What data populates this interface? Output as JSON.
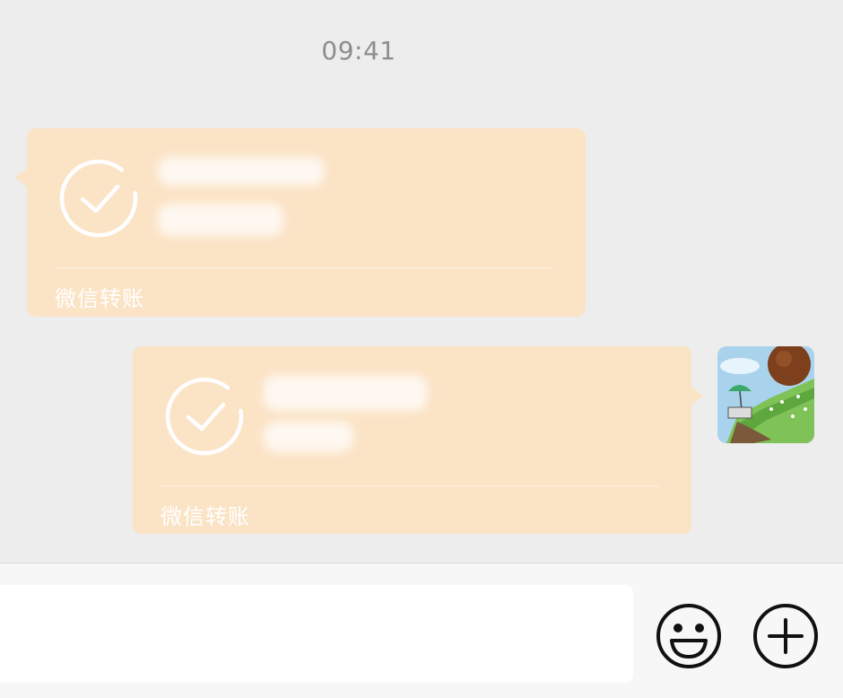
{
  "status": {
    "time": "09:41"
  },
  "messages": [
    {
      "side": "left",
      "type": "transfer",
      "icon": "check-circle-icon",
      "label": "微信转账",
      "amount_text": "",
      "note_text": ""
    },
    {
      "side": "right",
      "type": "transfer",
      "icon": "check-circle-icon",
      "label": "微信转账",
      "amount_text": "",
      "note_text": ""
    }
  ],
  "avatar": {
    "icon": "user-avatar-image"
  },
  "input_bar": {
    "input_value": "",
    "emoji_icon": "smiley-icon",
    "plus_icon": "plus-circle-icon"
  },
  "colors": {
    "background": "#ededed",
    "bubble": "#fbe3c6",
    "bubble_text": "#ffffff",
    "timestamp": "#8d8d8d"
  }
}
